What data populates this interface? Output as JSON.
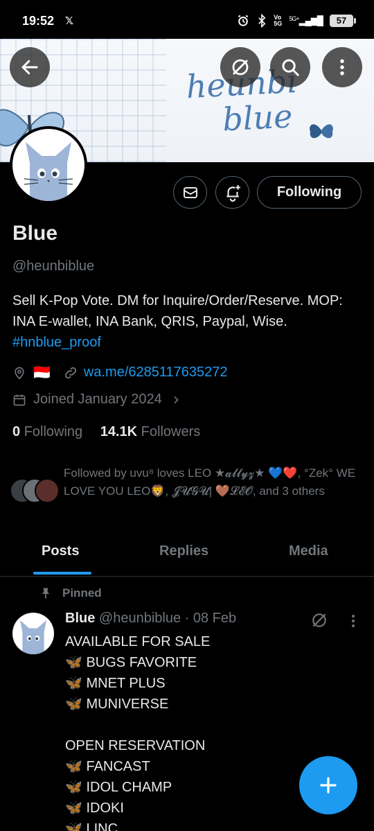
{
  "status_bar": {
    "time": "19:52",
    "notif_icon": "x-logo",
    "battery": "57",
    "network": "5G+"
  },
  "banner": {
    "line1": "heunbi",
    "line2": "blue"
  },
  "header_buttons": {
    "back": "back-arrow-icon",
    "grok": "grok-icon",
    "search": "search-icon",
    "more": "more-vertical-icon"
  },
  "profile": {
    "name": "Blue",
    "handle": "@heunbiblue",
    "bio_text": "Sell K-Pop Vote. DM for Inquire/Order/Reserve. MOP: INA E-wallet, INA Bank, QRIS, Paypal, Wise. ",
    "bio_hashtag": "#hnblue_proof",
    "location_flag": "🇮🇩",
    "website": "wa.me/6285117635272",
    "joined": "Joined January 2024",
    "following_count": "0",
    "following_label": "Following",
    "followers_count": "14.1K",
    "followers_label": "Followers",
    "following_button": "Following"
  },
  "followed_by": {
    "text": "Followed by uvu⁸ loves LEO ★𝓪𝓵𝓵𝔂𝔃★ 💙❤️, °Zek° WE LOVE YOU LEO🦁, 𝓙𝓤𝓖𝓤| 🤎𝓛𝓔𝓞, and 3 others"
  },
  "tabs": [
    {
      "label": "Posts",
      "active": true
    },
    {
      "label": "Replies",
      "active": false
    },
    {
      "label": "Media",
      "active": false
    }
  ],
  "pinned_post": {
    "pinned_label": "Pinned",
    "author_name": "Blue",
    "author_handle": "@heunbiblue",
    "date": "· 08 Feb",
    "lines": [
      "AVAILABLE FOR SALE",
      "🦋 BUGS FAVORITE",
      "🦋 MNET PLUS",
      "🦋 MUNIVERSE",
      "",
      "OPEN RESERVATION",
      "🦋 FANCAST",
      "🦋 IDOL CHAMP",
      "🦋 IDOKI",
      "🦋 LINC"
    ]
  },
  "fab": {
    "icon": "plus-icon"
  },
  "colors": {
    "accent": "#1d9bf0",
    "background": "#000000",
    "muted": "#71767b",
    "text": "#e7e9ea"
  }
}
